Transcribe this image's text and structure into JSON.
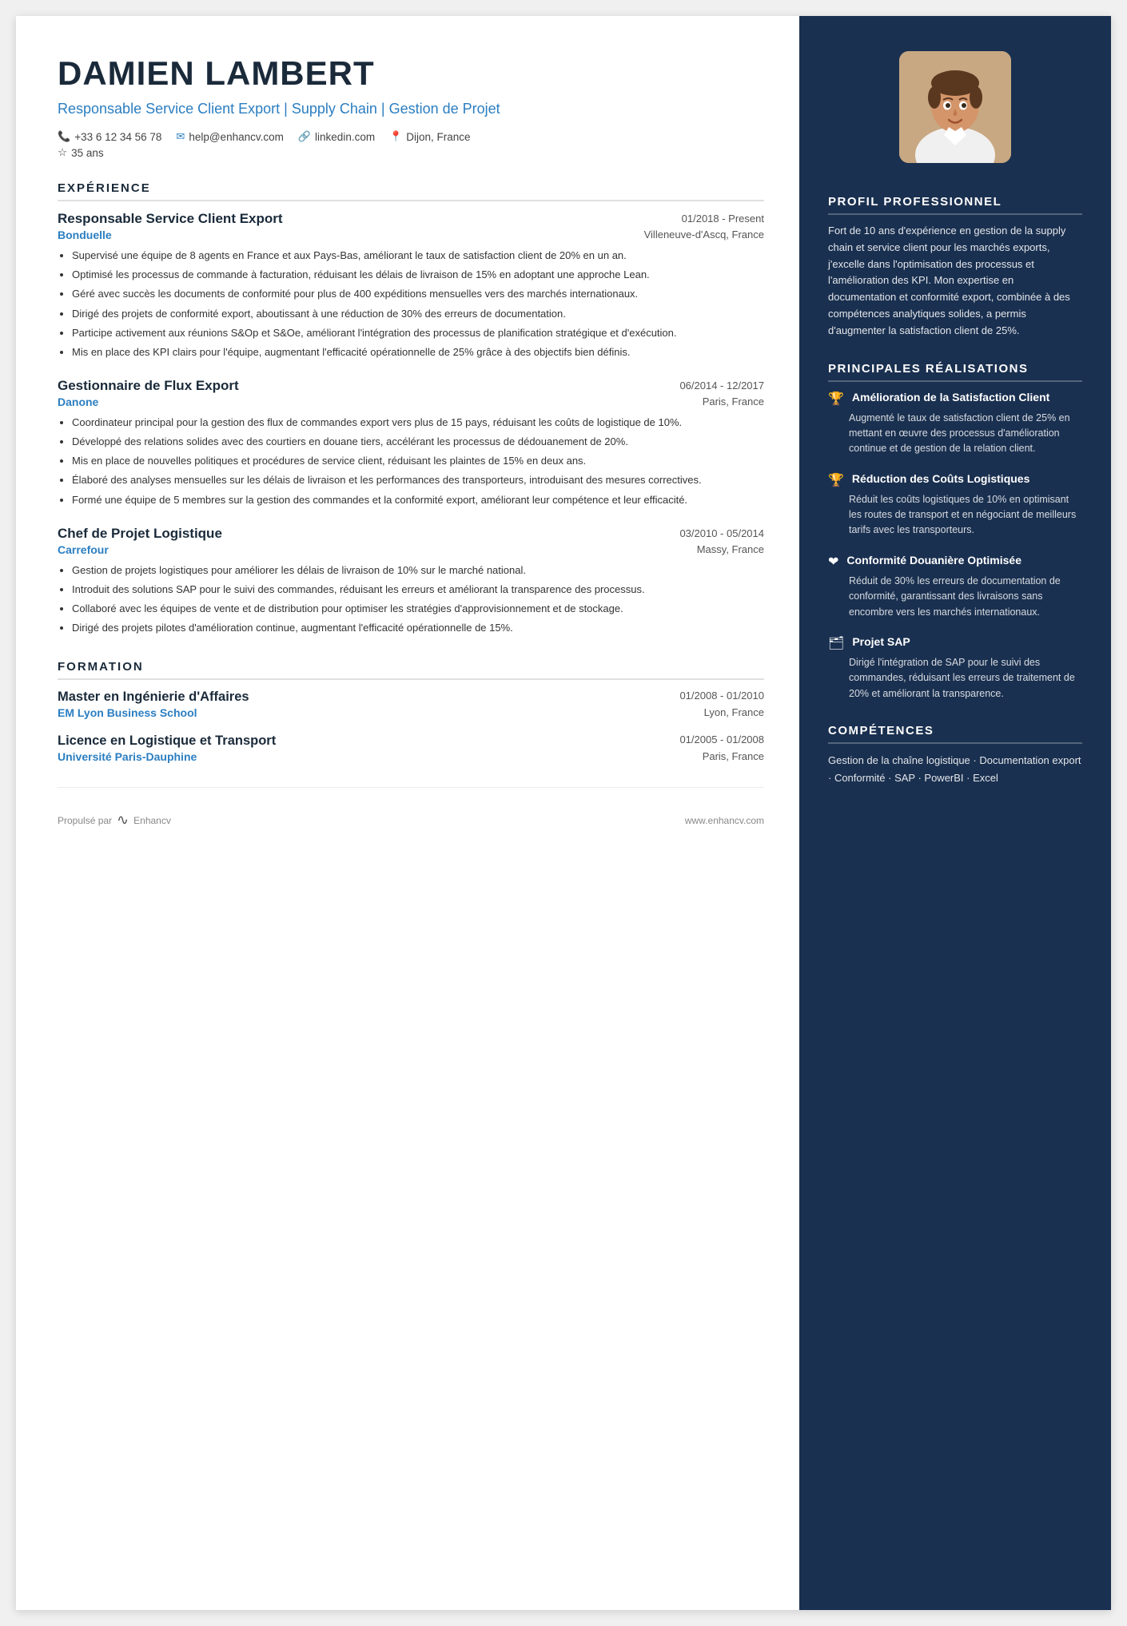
{
  "header": {
    "name": "DAMIEN LAMBERT",
    "subtitle": "Responsable Service Client Export | Supply Chain | Gestion de Projet",
    "phone": "+33 6 12 34 56 78",
    "email": "help@enhancv.com",
    "linkedin": "linkedin.com",
    "location": "Dijon, France",
    "age": "35 ans"
  },
  "experience_section_title": "EXPÉRIENCE",
  "experiences": [
    {
      "title": "Responsable Service Client Export",
      "dates": "01/2018 - Present",
      "company": "Bonduelle",
      "location": "Villeneuve-d'Ascq, France",
      "bullets": [
        "Supervisé une équipe de 8 agents en France et aux Pays-Bas, améliorant le taux de satisfaction client de 20% en un an.",
        "Optimisé les processus de commande à facturation, réduisant les délais de livraison de 15% en adoptant une approche Lean.",
        "Géré avec succès les documents de conformité pour plus de 400 expéditions mensuelles vers des marchés internationaux.",
        "Dirigé des projets de conformité export, aboutissant à une réduction de 30% des erreurs de documentation.",
        "Participe activement aux réunions S&Op et S&Oe, améliorant l'intégration des processus de planification stratégique et d'exécution.",
        "Mis en place des KPI clairs pour l'équipe, augmentant l'efficacité opérationnelle de 25% grâce à des objectifs bien définis."
      ]
    },
    {
      "title": "Gestionnaire de Flux Export",
      "dates": "06/2014 - 12/2017",
      "company": "Danone",
      "location": "Paris, France",
      "bullets": [
        "Coordinateur principal pour la gestion des flux de commandes export vers plus de 15 pays, réduisant les coûts de logistique de 10%.",
        "Développé des relations solides avec des courtiers en douane tiers, accélérant les processus de dédouanement de 20%.",
        "Mis en place de nouvelles politiques et procédures de service client, réduisant les plaintes de 15% en deux ans.",
        "Élaboré des analyses mensuelles sur les délais de livraison et les performances des transporteurs, introduisant des mesures correctives.",
        "Formé une équipe de 5 membres sur la gestion des commandes et la conformité export, améliorant leur compétence et leur efficacité."
      ]
    },
    {
      "title": "Chef de Projet Logistique",
      "dates": "03/2010 - 05/2014",
      "company": "Carrefour",
      "location": "Massy, France",
      "bullets": [
        "Gestion de projets logistiques pour améliorer les délais de livraison de 10% sur le marché national.",
        "Introduit des solutions SAP pour le suivi des commandes, réduisant les erreurs et améliorant la transparence des processus.",
        "Collaboré avec les équipes de vente et de distribution pour optimiser les stratégies d'approvisionnement et de stockage.",
        "Dirigé des projets pilotes d'amélioration continue, augmentant l'efficacité opérationnelle de 15%."
      ]
    }
  ],
  "formation_section_title": "FORMATION",
  "educations": [
    {
      "degree": "Master en Ingénierie d'Affaires",
      "dates": "01/2008 - 01/2010",
      "school": "EM Lyon Business School",
      "location": "Lyon, France"
    },
    {
      "degree": "Licence en Logistique et Transport",
      "dates": "01/2005 - 01/2008",
      "school": "Université Paris-Dauphine",
      "location": "Paris, France"
    }
  ],
  "footer": {
    "powered_by": "Propulsé par",
    "brand": "Enhancv",
    "website": "www.enhancv.com"
  },
  "right": {
    "profil_title": "PROFIL PROFESSIONNEL",
    "profil_text": "Fort de 10 ans d'expérience en gestion de la supply chain et service client pour les marchés exports, j'excelle dans l'optimisation des processus et l'amélioration des KPI. Mon expertise en documentation et conformité export, combinée à des compétences analytiques solides, a permis d'augmenter la satisfaction client de 25%.",
    "realisations_title": "PRINCIPALES RÉALISATIONS",
    "achievements": [
      {
        "icon": "🏆",
        "title": "Amélioration de la Satisfaction Client",
        "text": "Augmenté le taux de satisfaction client de 25% en mettant en œuvre des processus d'amélioration continue et de gestion de la relation client."
      },
      {
        "icon": "🏆",
        "title": "Réduction des Coûts Logistiques",
        "text": "Réduit les coûts logistiques de 10% en optimisant les routes de transport et en négociant de meilleurs tarifs avec les transporteurs."
      },
      {
        "icon": "❤",
        "title": "Conformité Douanière Optimisée",
        "text": "Réduit de 30% les erreurs de documentation de conformité, garantissant des livraisons sans encombre vers les marchés internationaux."
      },
      {
        "icon": "🖩",
        "title": "Projet SAP",
        "text": "Dirigé l'intégration de SAP pour le suivi des commandes, réduisant les erreurs de traitement de 20% et améliorant la transparence."
      }
    ],
    "competences_title": "COMPÉTENCES",
    "competences_text": "Gestion de la chaîne logistique · Documentation export · Conformité · SAP · PowerBI · Excel"
  }
}
